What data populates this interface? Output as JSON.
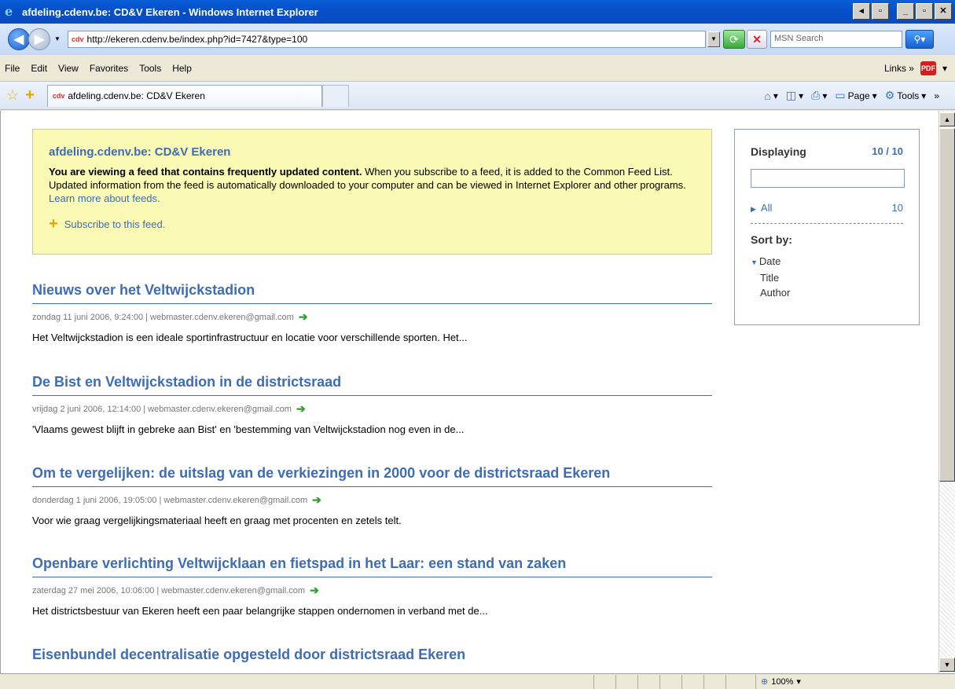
{
  "window": {
    "title": "afdeling.cdenv.be: CD&V Ekeren - Windows Internet Explorer"
  },
  "address_bar": {
    "url": "http://ekeren.cdenv.be/index.php?id=7427&type=100",
    "search_placeholder": "MSN Search"
  },
  "menu": {
    "items": [
      "File",
      "Edit",
      "View",
      "Favorites",
      "Tools",
      "Help"
    ],
    "links_label": "Links"
  },
  "tabs": {
    "active_tab": "afdeling.cdenv.be: CD&V Ekeren"
  },
  "commands": {
    "page_label": "Page",
    "tools_label": "Tools"
  },
  "feed_header": {
    "title": "afdeling.cdenv.be: CD&V Ekeren",
    "bold_text": "You are viewing a feed that contains frequently updated content.",
    "description": " When you subscribe to a feed, it is added to the Common Feed List. Updated information from the feed is automatically downloaded to your computer and can be viewed in Internet Explorer and other programs. ",
    "learn_more": "Learn more about feeds.",
    "subscribe": "Subscribe to this feed."
  },
  "entries": [
    {
      "title": "Nieuws over het Veltwijckstadion",
      "meta": "zondag 11 juni 2006, 9:24:00 | webmaster.cdenv.ekeren@gmail.com",
      "summary": "Het Veltwijckstadion is een ideale sportinfrastructuur en locatie voor verschillende sporten. Het..."
    },
    {
      "title": "De Bist en Veltwijckstadion in de districtsraad",
      "meta": "vrijdag 2 juni 2006, 12:14:00 | webmaster.cdenv.ekeren@gmail.com",
      "summary": "'Vlaams gewest blijft in gebreke aan Bist' en 'bestemming van Veltwijckstadion nog even in de..."
    },
    {
      "title": "Om te vergelijken: de uitslag van de verkiezingen in 2000 voor de districtsraad Ekeren",
      "meta": "donderdag 1 juni 2006, 19:05:00 | webmaster.cdenv.ekeren@gmail.com",
      "summary": "Voor wie graag vergelijkingsmateriaal heeft en graag met procenten en zetels telt."
    },
    {
      "title": "Openbare verlichting Veltwijcklaan en fietspad in het Laar: een stand van zaken",
      "meta": "zaterdag 27 mei 2006, 10:06:00 | webmaster.cdenv.ekeren@gmail.com",
      "summary": "Het districtsbestuur van Ekeren heeft een paar belangrijke stappen ondernomen in verband met de..."
    },
    {
      "title": "Eisenbundel decentralisatie opgesteld door districtsraad Ekeren",
      "meta": "",
      "summary": ""
    }
  ],
  "sidebar": {
    "displaying_label": "Displaying",
    "displaying_count": "10 / 10",
    "all_label": "All",
    "all_count": "10",
    "sort_by_label": "Sort by:",
    "sort_options": [
      "Date",
      "Title",
      "Author"
    ]
  },
  "status_bar": {
    "zoom": "100%"
  }
}
